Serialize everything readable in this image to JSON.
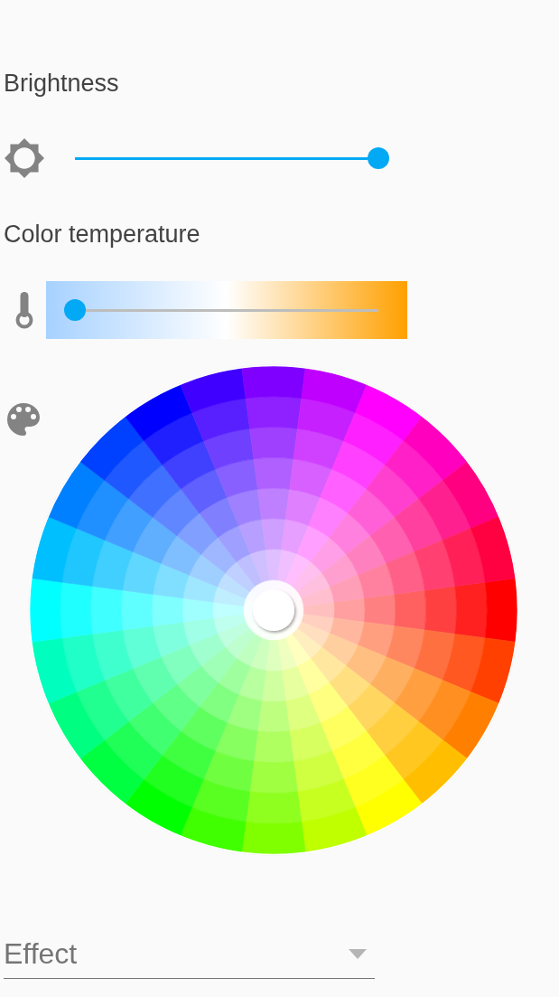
{
  "brightness": {
    "label": "Brightness",
    "level": 1
  },
  "color_temperature": {
    "label": "Color temperature",
    "level": 0
  },
  "effect": {
    "placeholder": "Effect"
  }
}
